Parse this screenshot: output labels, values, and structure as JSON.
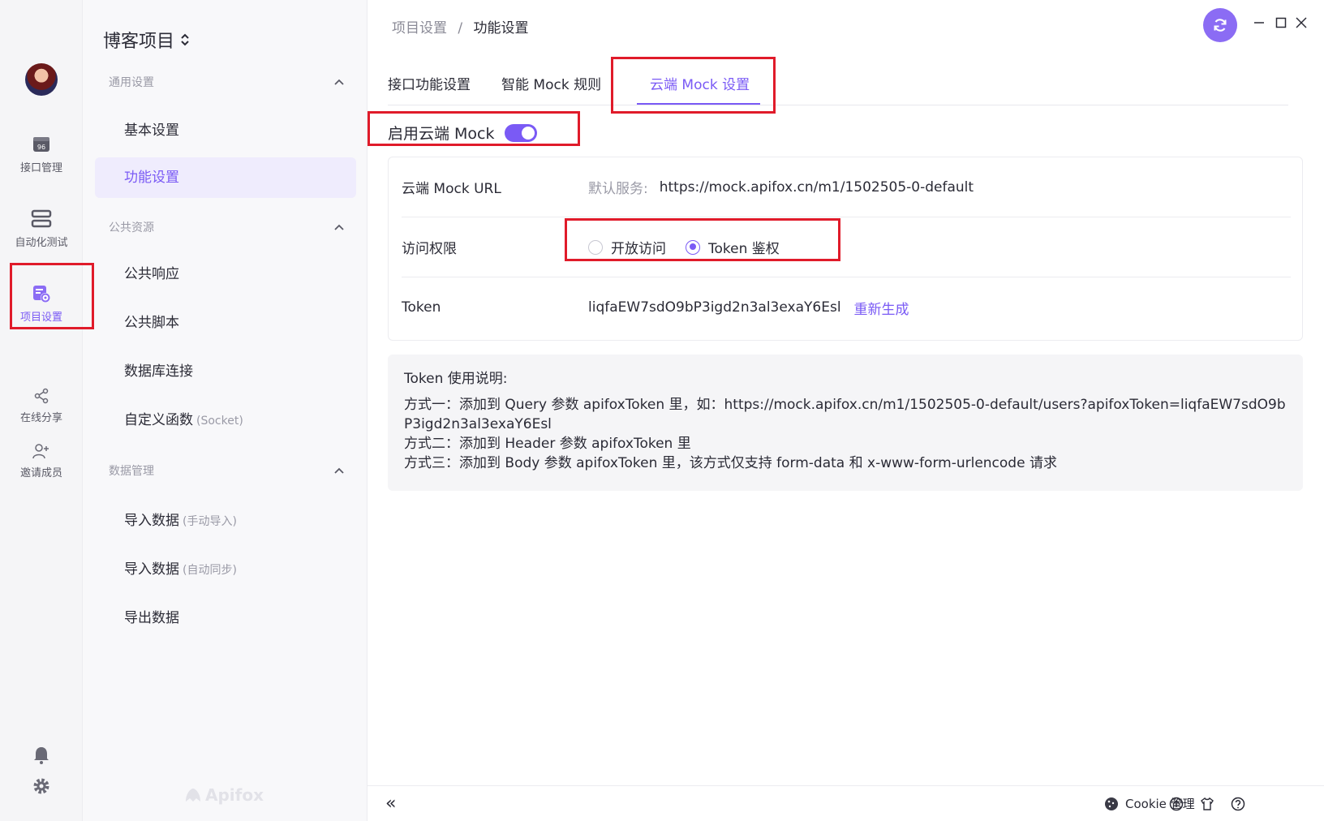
{
  "rail": {
    "items": [
      {
        "label": "接口管理",
        "icon": "api-management-icon"
      },
      {
        "label": "自动化测试",
        "icon": "automation-test-icon"
      },
      {
        "label": "项目设置",
        "icon": "project-settings-icon"
      },
      {
        "label": "在线分享",
        "icon": "share-icon"
      },
      {
        "label": "邀请成员",
        "icon": "invite-member-icon"
      }
    ],
    "active_index": 2,
    "bottom_icons": [
      "bell-icon",
      "gear-icon"
    ]
  },
  "sidebar": {
    "project_name": "博客项目",
    "groups": [
      {
        "title": "通用设置",
        "items": [
          {
            "label": "基本设置"
          },
          {
            "label": "功能设置",
            "active": true
          }
        ]
      },
      {
        "title": "公共资源",
        "items": [
          {
            "label": "公共响应"
          },
          {
            "label": "公共脚本"
          },
          {
            "label": "数据库连接"
          },
          {
            "label": "自定义函数",
            "hint": "(Socket)"
          }
        ]
      },
      {
        "title": "数据管理",
        "items": [
          {
            "label": "导入数据",
            "hint": "(手动导入)"
          },
          {
            "label": "导入数据",
            "hint": "(自动同步)"
          },
          {
            "label": "导出数据"
          }
        ]
      }
    ],
    "brand": "Apifox"
  },
  "breadcrumb": {
    "parent": "项目设置",
    "separator": "/",
    "current": "功能设置"
  },
  "tabs": [
    {
      "label": "接口功能设置"
    },
    {
      "label": "智能 Mock 规则"
    },
    {
      "label": "云端 Mock 设置",
      "active": true
    }
  ],
  "cloud_mock": {
    "enable_label": "启用云端 Mock",
    "enabled": true,
    "url_label": "云端 Mock URL",
    "url_prefix": "默认服务:",
    "url": "https://mock.apifox.cn/m1/1502505-0-default",
    "access_label": "访问权限",
    "access_options": [
      {
        "label": "开放访问",
        "selected": false
      },
      {
        "label": "Token 鉴权",
        "selected": true
      }
    ],
    "token_label": "Token",
    "token_value": "liqfaEW7sdO9bP3igd2n3al3exaY6Esl",
    "regenerate_label": "重新生成"
  },
  "token_note": {
    "title": "Token 使用说明:",
    "lines": [
      "方式一：添加到 Query 参数 apifoxToken 里，如：https://mock.apifox.cn/m1/1502505-0-default/users?apifoxToken=liqfaEW7sdO9bP3igd2n3al3exaY6Esl",
      "方式二：添加到 Header 参数 apifoxToken 里",
      "方式三：添加到 Body 参数 apifoxToken 里，该方式仅支持 form-data 和 x-www-form-urlencode 请求"
    ]
  },
  "footer": {
    "collapse_glyph": "«",
    "cookie_label": "Cookie 管理"
  },
  "colors": {
    "accent": "#7a5af5",
    "highlight_box": "#e01b2a"
  }
}
